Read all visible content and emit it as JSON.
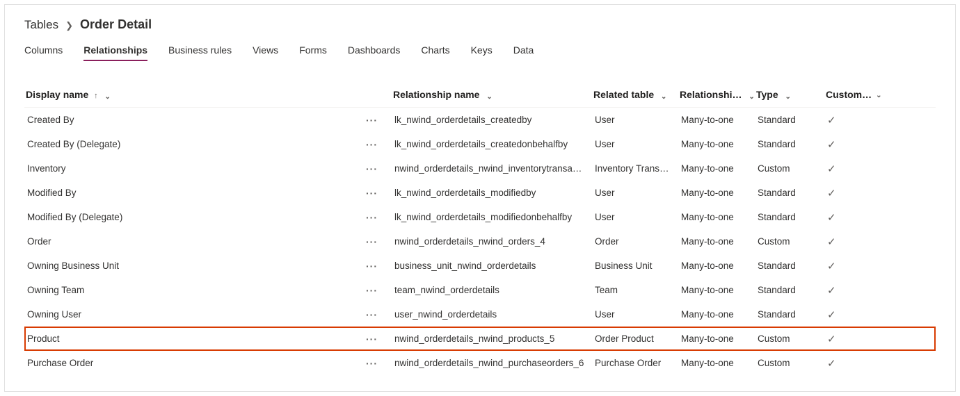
{
  "breadcrumb": {
    "root": "Tables",
    "leaf": "Order Detail"
  },
  "tabs": [
    "Columns",
    "Relationships",
    "Business rules",
    "Views",
    "Forms",
    "Dashboards",
    "Charts",
    "Keys",
    "Data"
  ],
  "activeTab": 1,
  "columns": {
    "displayName": "Display name",
    "relationshipName": "Relationship name",
    "relatedTable": "Related table",
    "relationship": "Relationshi…",
    "type": "Type",
    "customizable": "Custom…"
  },
  "rows": [
    {
      "name": "Created By",
      "rel": "lk_nwind_orderdetails_createdby",
      "table": "User",
      "rtype": "Many-to-one",
      "kind": "Standard",
      "custom": true,
      "highlight": false
    },
    {
      "name": "Created By (Delegate)",
      "rel": "lk_nwind_orderdetails_createdonbehalfby",
      "table": "User",
      "rtype": "Many-to-one",
      "kind": "Standard",
      "custom": true,
      "highlight": false
    },
    {
      "name": "Inventory",
      "rel": "nwind_orderdetails_nwind_inventorytransa…",
      "table": "Inventory Trans…",
      "rtype": "Many-to-one",
      "kind": "Custom",
      "custom": true,
      "highlight": false
    },
    {
      "name": "Modified By",
      "rel": "lk_nwind_orderdetails_modifiedby",
      "table": "User",
      "rtype": "Many-to-one",
      "kind": "Standard",
      "custom": true,
      "highlight": false
    },
    {
      "name": "Modified By (Delegate)",
      "rel": "lk_nwind_orderdetails_modifiedonbehalfby",
      "table": "User",
      "rtype": "Many-to-one",
      "kind": "Standard",
      "custom": true,
      "highlight": false
    },
    {
      "name": "Order",
      "rel": "nwind_orderdetails_nwind_orders_4",
      "table": "Order",
      "rtype": "Many-to-one",
      "kind": "Custom",
      "custom": true,
      "highlight": false
    },
    {
      "name": "Owning Business Unit",
      "rel": "business_unit_nwind_orderdetails",
      "table": "Business Unit",
      "rtype": "Many-to-one",
      "kind": "Standard",
      "custom": true,
      "highlight": false
    },
    {
      "name": "Owning Team",
      "rel": "team_nwind_orderdetails",
      "table": "Team",
      "rtype": "Many-to-one",
      "kind": "Standard",
      "custom": true,
      "highlight": false
    },
    {
      "name": "Owning User",
      "rel": "user_nwind_orderdetails",
      "table": "User",
      "rtype": "Many-to-one",
      "kind": "Standard",
      "custom": true,
      "highlight": false
    },
    {
      "name": "Product",
      "rel": "nwind_orderdetails_nwind_products_5",
      "table": "Order Product",
      "rtype": "Many-to-one",
      "kind": "Custom",
      "custom": true,
      "highlight": true
    },
    {
      "name": "Purchase Order",
      "rel": "nwind_orderdetails_nwind_purchaseorders_6",
      "table": "Purchase Order",
      "rtype": "Many-to-one",
      "kind": "Custom",
      "custom": true,
      "highlight": false
    }
  ]
}
